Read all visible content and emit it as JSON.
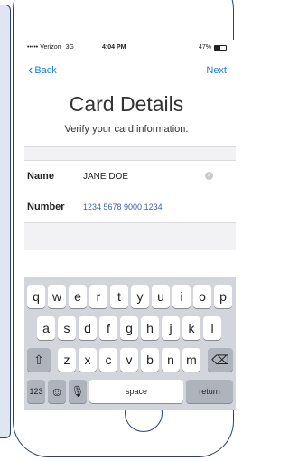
{
  "status_bar": {
    "carrier": "••••• Verizon",
    "network": "3G",
    "time": "4:04 PM",
    "battery_percent": "47%",
    "battery_level": 0.47
  },
  "nav": {
    "back_label": "Back",
    "next_label": "Next"
  },
  "header": {
    "title": "Card Details",
    "subtitle": "Verify your card information."
  },
  "form": {
    "name_label": "Name",
    "name_value": "JANE DOE",
    "number_label": "Number",
    "number_value": "1234 5678 9000 1234"
  },
  "keyboard": {
    "row1": [
      "q",
      "w",
      "e",
      "r",
      "t",
      "y",
      "u",
      "i",
      "o",
      "p"
    ],
    "row2": [
      "a",
      "s",
      "d",
      "f",
      "g",
      "h",
      "j",
      "k",
      "l"
    ],
    "row3": [
      "z",
      "x",
      "c",
      "v",
      "b",
      "n",
      "m"
    ],
    "shift_icon": "⇧",
    "delete_icon": "⌫",
    "numbers_label": "123",
    "emoji_icon": "☺",
    "mic_icon": "🎙",
    "space_label": "space",
    "return_label": "return"
  },
  "icons": {
    "back": "chevron-left-icon",
    "clear": "clear-field-icon",
    "battery": "battery-icon",
    "shift": "shift-icon",
    "delete": "delete-icon",
    "emoji": "emoji-icon",
    "mic": "microphone-icon"
  },
  "colors": {
    "accent": "#1a7cf4",
    "outline": "#2d3e7c",
    "number_text": "#3f5fa8",
    "keyboard_bg": "#d2d5db"
  }
}
